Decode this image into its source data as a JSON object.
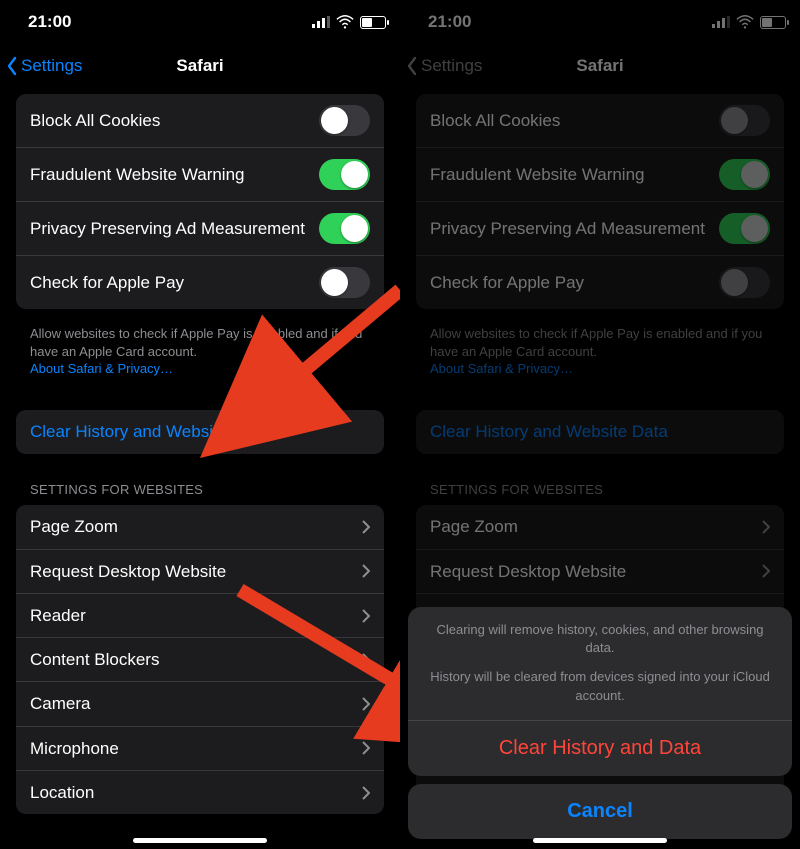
{
  "status": {
    "time": "21:00"
  },
  "nav": {
    "back": "Settings",
    "title": "Safari"
  },
  "privacy": {
    "blockCookies": {
      "label": "Block All Cookies",
      "on": false
    },
    "fraud": {
      "label": "Fraudulent Website Warning",
      "on": true
    },
    "ppam": {
      "label": "Privacy Preserving Ad Measurement",
      "on": true
    },
    "applePay": {
      "label": "Check for Apple Pay",
      "on": false
    },
    "footer1": "Allow websites to check if Apple Pay is enabled and if you have an Apple Card account.",
    "footerLink": "About Safari & Privacy…"
  },
  "clearRow": "Clear History and Website Data",
  "websitesHeader": "SETTINGS FOR WEBSITES",
  "websites": [
    "Page Zoom",
    "Request Desktop Website",
    "Reader",
    "Content Blockers",
    "Camera",
    "Microphone",
    "Location"
  ],
  "sheet": {
    "msg1": "Clearing will remove history, cookies, and other browsing data.",
    "msg2": "History will be cleared from devices signed into your iCloud account.",
    "clear": "Clear History and Data",
    "cancel": "Cancel"
  }
}
